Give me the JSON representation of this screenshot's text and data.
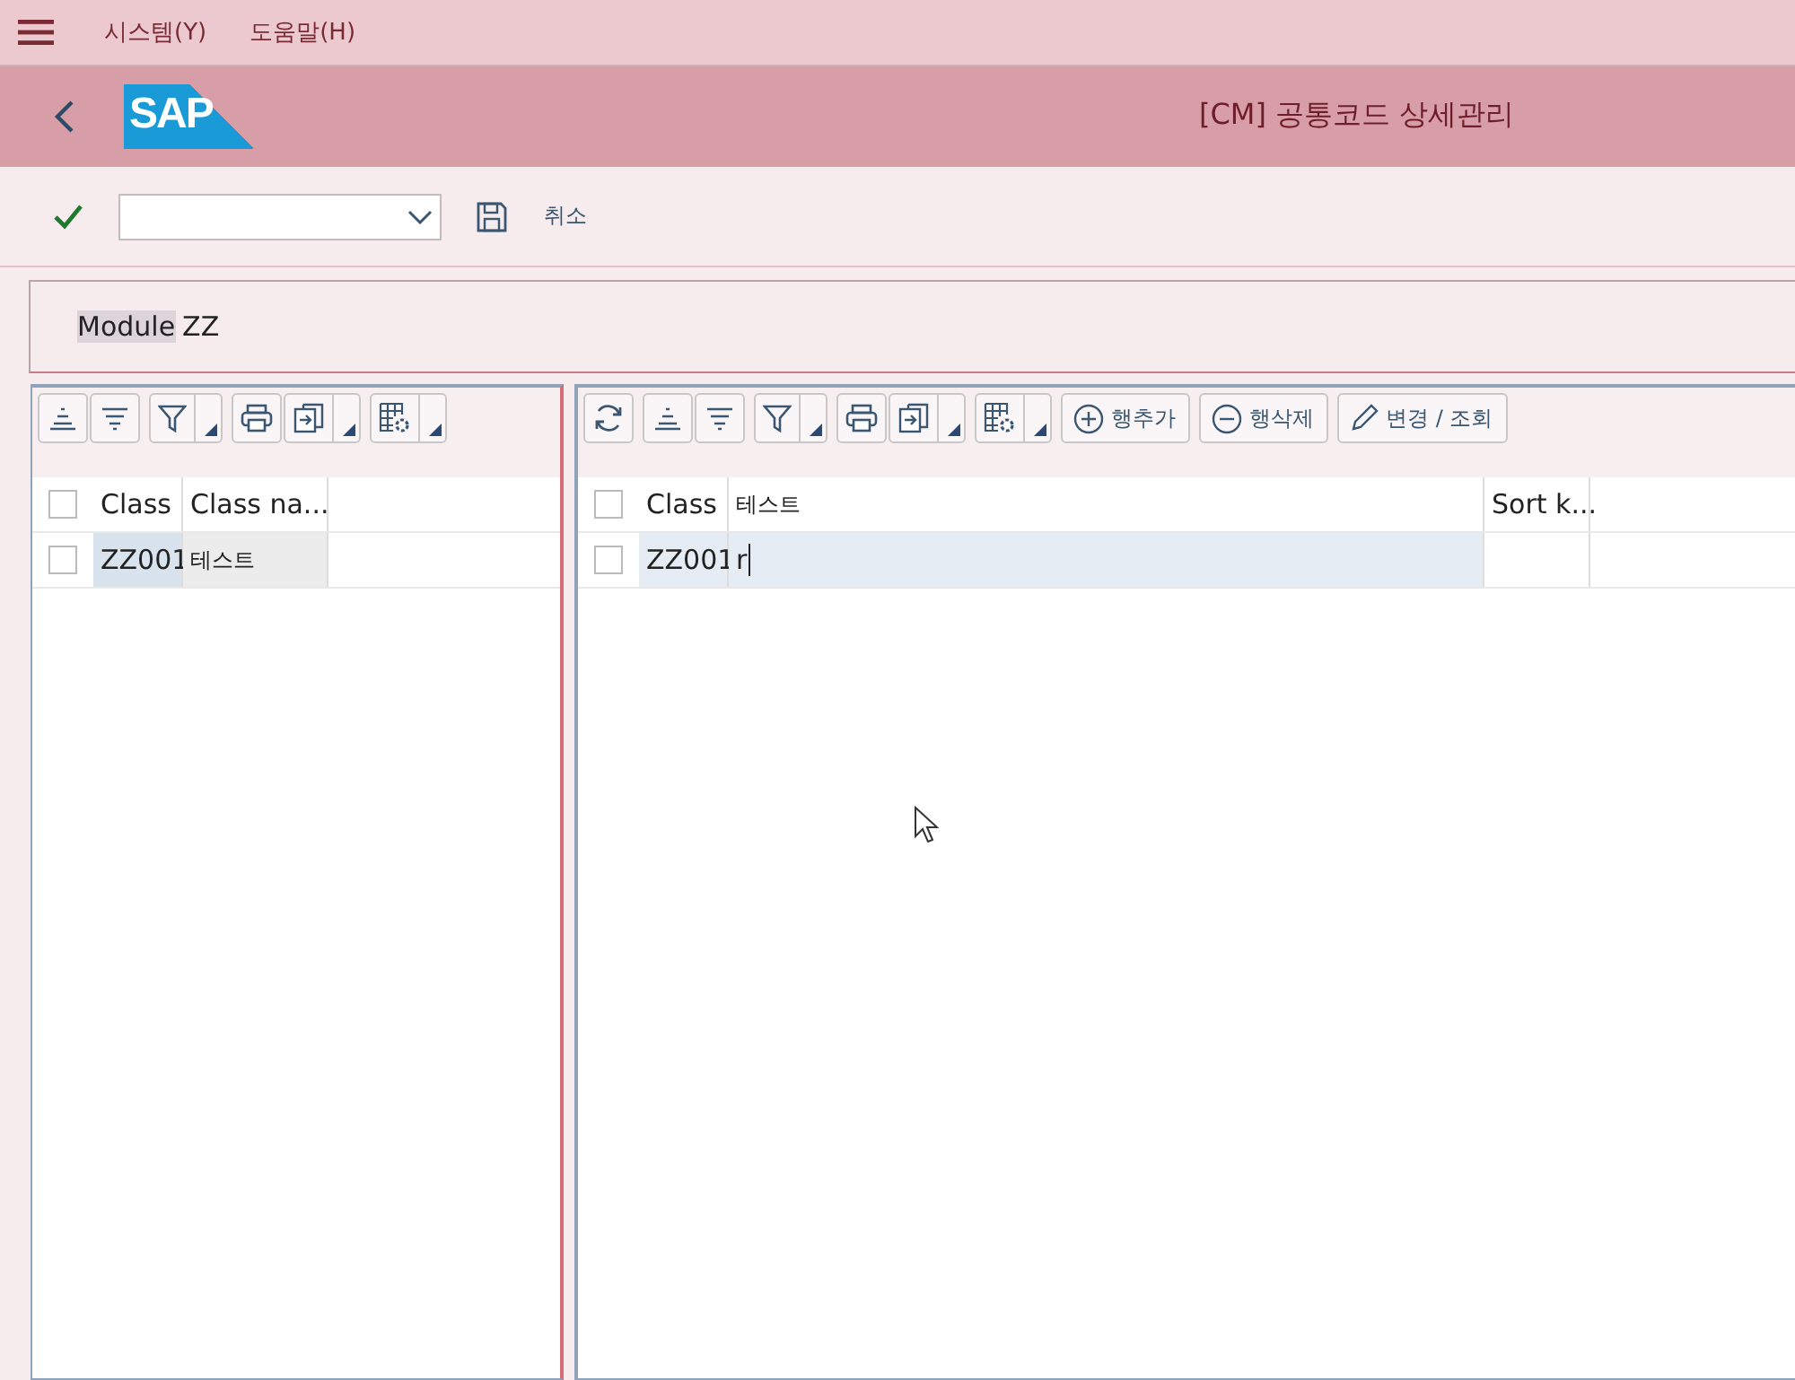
{
  "menu": [
    {
      "label": "시스템(Y)"
    },
    {
      "label": "도움말(H)"
    }
  ],
  "logo": "SAP",
  "title": "[CM] 공통코드 상세관리",
  "toolbar": {
    "cancel": "취소"
  },
  "module": {
    "label": "Module",
    "value": "ZZ"
  },
  "left_grid": {
    "tools": [
      {
        "kind": "sort-asc",
        "dropdown": false
      },
      {
        "kind": "sort-desc",
        "dropdown": false
      },
      {
        "kind": "filter",
        "dropdown": true
      },
      {
        "kind": "print",
        "dropdown": false
      },
      {
        "kind": "export",
        "dropdown": true
      },
      {
        "kind": "layout",
        "dropdown": true
      }
    ],
    "select_all": {
      "checked": false
    },
    "columns": [
      "Class",
      "Class na..."
    ],
    "rows": [
      {
        "selected": false,
        "cells": [
          "ZZ001",
          "테스트"
        ]
      }
    ]
  },
  "right_grid": {
    "tools": [
      {
        "kind": "refresh",
        "dropdown": false
      },
      {
        "kind": "sort-asc",
        "dropdown": false
      },
      {
        "kind": "sort-desc",
        "dropdown": false
      },
      {
        "kind": "filter",
        "dropdown": true
      },
      {
        "kind": "print",
        "dropdown": false
      },
      {
        "kind": "export",
        "dropdown": true
      },
      {
        "kind": "layout",
        "dropdown": true
      },
      {
        "kind": "add",
        "dropdown": false,
        "label": "행추가"
      },
      {
        "kind": "delete",
        "dropdown": false,
        "label": "행삭제"
      },
      {
        "kind": "edit",
        "dropdown": false,
        "label": "변경 / 조회"
      }
    ],
    "select_all": {
      "checked": false
    },
    "columns": [
      "Class",
      "테스트",
      "Sort k..."
    ],
    "rows": [
      {
        "selected": false,
        "cells": [
          "ZZ001"
        ],
        "editing": "r"
      }
    ]
  }
}
